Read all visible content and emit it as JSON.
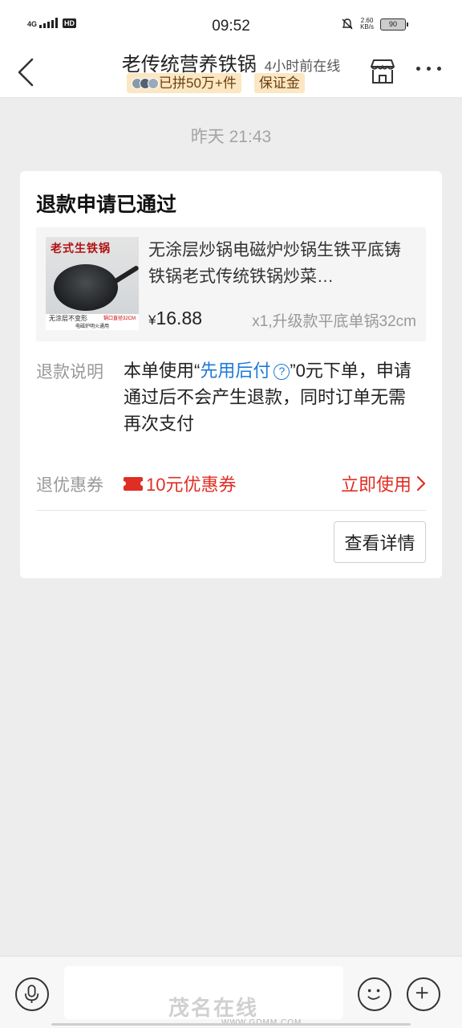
{
  "status_bar": {
    "network": "4G",
    "hd": "HD",
    "time": "09:52",
    "speed_value": "2.60",
    "speed_unit": "KB/s",
    "battery": "90"
  },
  "header": {
    "title": "老传统营养铁锅",
    "online_status": "4小时前在线",
    "badge_sold": "已拼50万+件",
    "badge_deposit": "保证金"
  },
  "chat": {
    "timestamp": "昨天 21:43"
  },
  "card": {
    "title": "退款申请已通过",
    "product": {
      "image_brand_text": "老式生铁锅",
      "image_caption_left": "无涂层不变形",
      "image_caption_right": "锅口直径32CM",
      "image_caption_bottom": "电磁炉明火通用",
      "name": "无涂层炒锅电磁炉炒锅生铁平底铸铁锅老式传统铁锅炒菜…",
      "currency": "¥",
      "price": "16.88",
      "spec": "x1,升级款平底单锅32cm"
    },
    "refund_label": "退款说明",
    "refund_text_1": "本单使用“",
    "refund_link": "先用后付",
    "refund_help": "?",
    "refund_text_2": "”0元下单，申请通过后不会产生退款，同时订单无需再次支付",
    "coupon_label": "退优惠券",
    "coupon_value": "10元优惠券",
    "use_now": "立即使用",
    "detail_button": "查看详情"
  },
  "bottom_bar": {
    "input_placeholder": "",
    "watermark": "茂名在线",
    "watermark_url": "WWW.GDMM.COM"
  },
  "colors": {
    "accent_red": "#e02e24",
    "link_blue": "#1c7ad8",
    "badge_bg": "#fbe7c2"
  }
}
